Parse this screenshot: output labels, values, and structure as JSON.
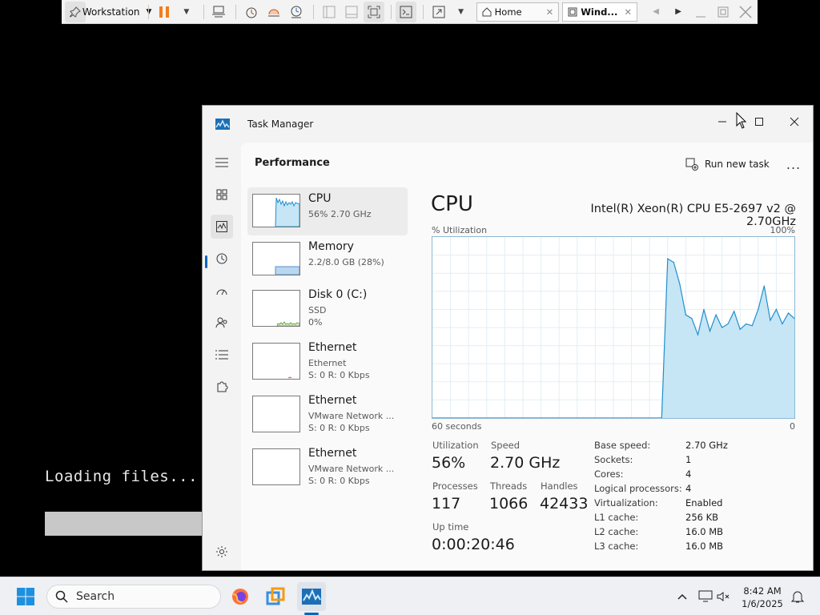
{
  "vm_toolbar": {
    "workstation_label": "Workstation",
    "tabs": [
      {
        "label": "Home"
      },
      {
        "label": "Wind..."
      }
    ]
  },
  "background": {
    "loading_text": "Loading files..."
  },
  "window": {
    "title": "Task Manager"
  },
  "header": {
    "section_title": "Performance",
    "run_new_task": "Run new task",
    "more": "..."
  },
  "devices": [
    {
      "name": "CPU",
      "line1": "56% 2.70 GHz",
      "line2": ""
    },
    {
      "name": "Memory",
      "line1": "2.2/8.0 GB (28%)",
      "line2": ""
    },
    {
      "name": "Disk 0 (C:)",
      "line1": "SSD",
      "line2": "0%"
    },
    {
      "name": "Ethernet",
      "line1": "Ethernet",
      "line2": "S: 0 R: 0 Kbps"
    },
    {
      "name": "Ethernet",
      "line1": "VMware Network ...",
      "line2": "S: 0 R: 0 Kbps"
    },
    {
      "name": "Ethernet",
      "line1": "VMware Network ...",
      "line2": "S: 0 R: 0 Kbps"
    }
  ],
  "cpu": {
    "heading": "CPU",
    "model": "Intel(R) Xeon(R) CPU E5-2697 v2 @ 2.70GHz",
    "graph": {
      "y_label": "% Utilization",
      "y_max_label": "100%",
      "x_left_label": "60 seconds",
      "x_right_label": "0"
    },
    "stats": {
      "utilization_label": "Utilization",
      "utilization": "56%",
      "speed_label": "Speed",
      "speed": "2.70 GHz",
      "processes_label": "Processes",
      "processes": "117",
      "threads_label": "Threads",
      "threads": "1066",
      "handles_label": "Handles",
      "handles": "42433",
      "uptime_label": "Up time",
      "uptime": "0:00:20:46"
    },
    "details": [
      {
        "label": "Base speed:",
        "value": "2.70 GHz"
      },
      {
        "label": "Sockets:",
        "value": "1"
      },
      {
        "label": "Cores:",
        "value": "4"
      },
      {
        "label": "Logical processors:",
        "value": "4"
      },
      {
        "label": "Virtualization:",
        "value": "Enabled"
      },
      {
        "label": "L1 cache:",
        "value": "256 KB"
      },
      {
        "label": "L2 cache:",
        "value": "16.0 MB"
      },
      {
        "label": "L3 cache:",
        "value": "16.0 MB"
      }
    ]
  },
  "chart_data": {
    "type": "area",
    "title": "",
    "xlabel": "60 seconds",
    "ylabel": "% Utilization",
    "xlim": [
      60,
      0
    ],
    "ylim": [
      0,
      100
    ],
    "grid": true,
    "color": "#1f8fce",
    "fill": "#c6e6f5",
    "x": [
      60,
      59,
      58,
      57,
      56,
      55,
      54,
      53,
      52,
      51,
      50,
      49,
      48,
      47,
      46,
      45,
      44,
      43,
      42,
      41,
      40,
      39,
      38,
      37,
      36,
      35,
      34,
      33,
      32,
      31,
      30,
      29,
      28,
      27,
      26,
      25,
      24,
      23,
      22,
      21,
      20,
      19,
      18,
      17,
      16,
      15,
      14,
      13,
      12,
      11,
      10,
      9,
      8,
      7,
      6,
      5,
      4,
      3,
      2,
      1,
      0
    ],
    "values": [
      0,
      0,
      0,
      0,
      0,
      0,
      0,
      0,
      0,
      0,
      0,
      0,
      0,
      0,
      0,
      0,
      0,
      0,
      0,
      0,
      0,
      0,
      0,
      0,
      0,
      0,
      0,
      0,
      0,
      0,
      0,
      0,
      0,
      0,
      0,
      0,
      0,
      0,
      0,
      88,
      86,
      74,
      57,
      55,
      46,
      60,
      48,
      57,
      50,
      52,
      59,
      49,
      52,
      51,
      60,
      73,
      54,
      60,
      52,
      58,
      55
    ]
  },
  "taskbar": {
    "search_placeholder": "Search",
    "time": "8:42 AM",
    "date": "1/6/2025"
  },
  "colors": {
    "accent": "#0067c0",
    "graph_line": "#1f8fce",
    "graph_fill": "#c6e6f5",
    "mem_fill": "#b9d7ef"
  }
}
